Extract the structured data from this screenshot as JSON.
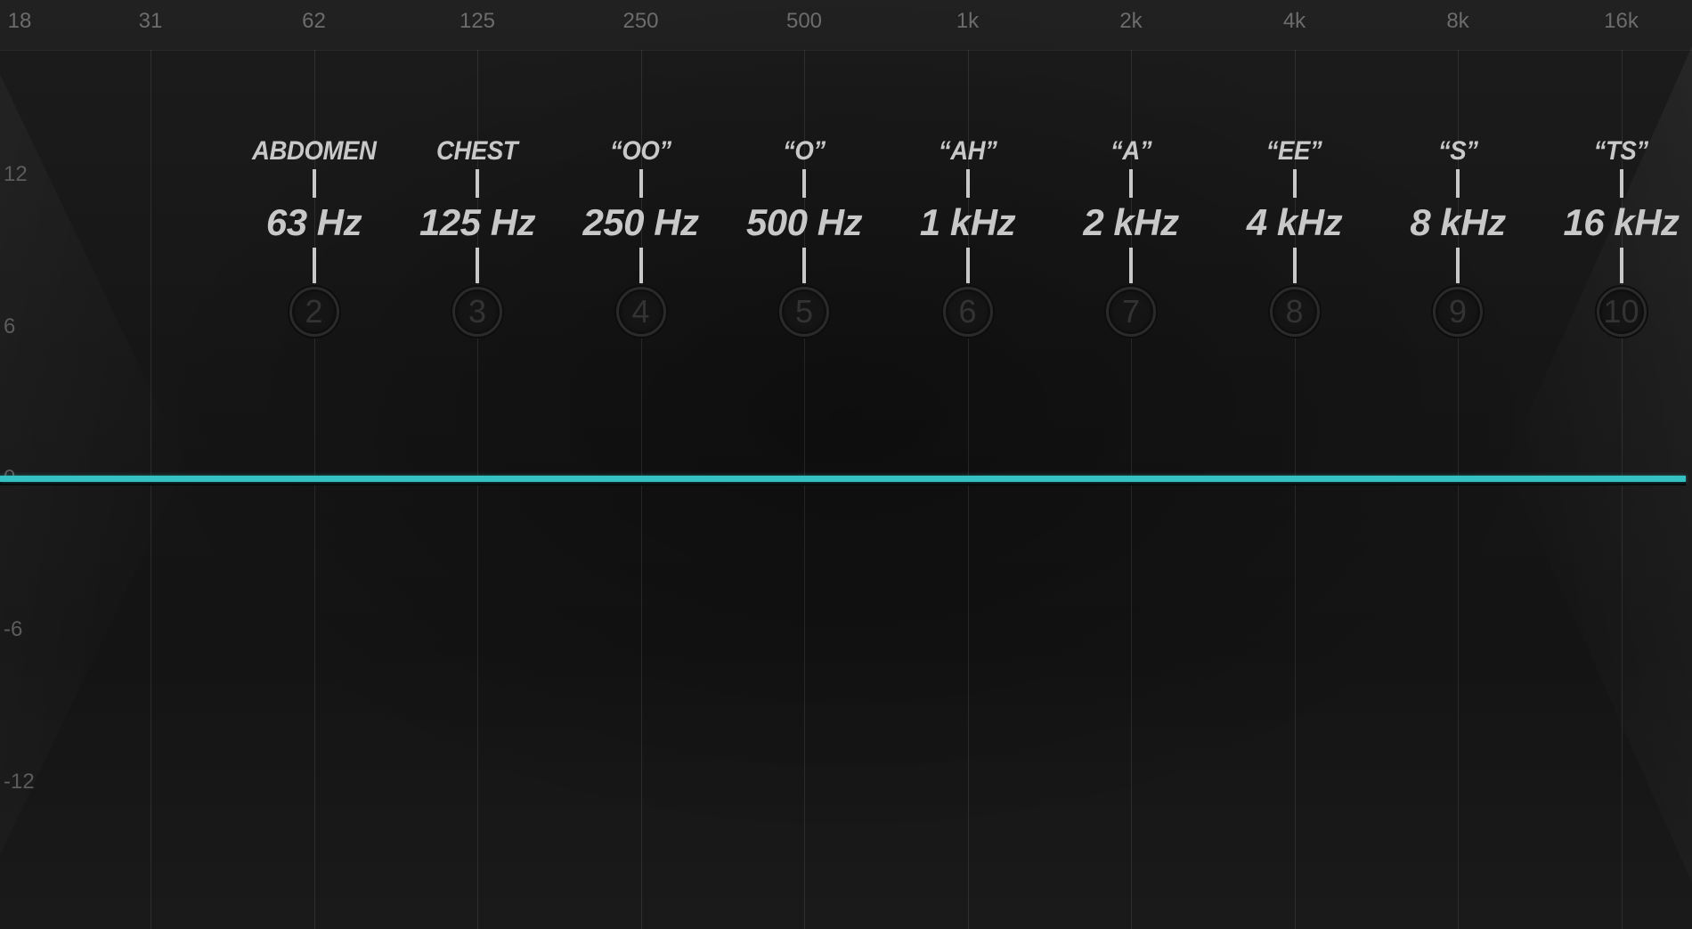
{
  "chart_data": {
    "type": "line",
    "title": "",
    "xlabel": "",
    "ylabel": "",
    "x_ticks": [
      "18",
      "31",
      "62",
      "125",
      "250",
      "500",
      "1k",
      "2k",
      "4k",
      "8k",
      "16k"
    ],
    "y_ticks": [
      "12",
      "6",
      "0",
      "-6",
      "-12"
    ],
    "ylim": [
      -18,
      18
    ],
    "series": [
      {
        "x": [
          18,
          16000
        ],
        "y": [
          0,
          0
        ],
        "color": "#35c1c4"
      }
    ]
  },
  "bands": [
    {
      "label": "ABDOMEN",
      "freq": "63 Hz",
      "num": "2"
    },
    {
      "label": "CHEST",
      "freq": "125 Hz",
      "num": "3"
    },
    {
      "label": "“OO”",
      "freq": "250 Hz",
      "num": "4"
    },
    {
      "label": "“O”",
      "freq": "500 Hz",
      "num": "5"
    },
    {
      "label": "“AH”",
      "freq": "1 kHz",
      "num": "6"
    },
    {
      "label": "“A”",
      "freq": "2 kHz",
      "num": "7"
    },
    {
      "label": "“EE”",
      "freq": "4 kHz",
      "num": "8"
    },
    {
      "label": "“S”",
      "freq": "8 kHz",
      "num": "9"
    },
    {
      "label": "“TS”",
      "freq": "16 kHz",
      "num": "10"
    }
  ],
  "colors": {
    "curve": "#35c1c4",
    "label": "#c8c8c8",
    "background": "#161616"
  }
}
